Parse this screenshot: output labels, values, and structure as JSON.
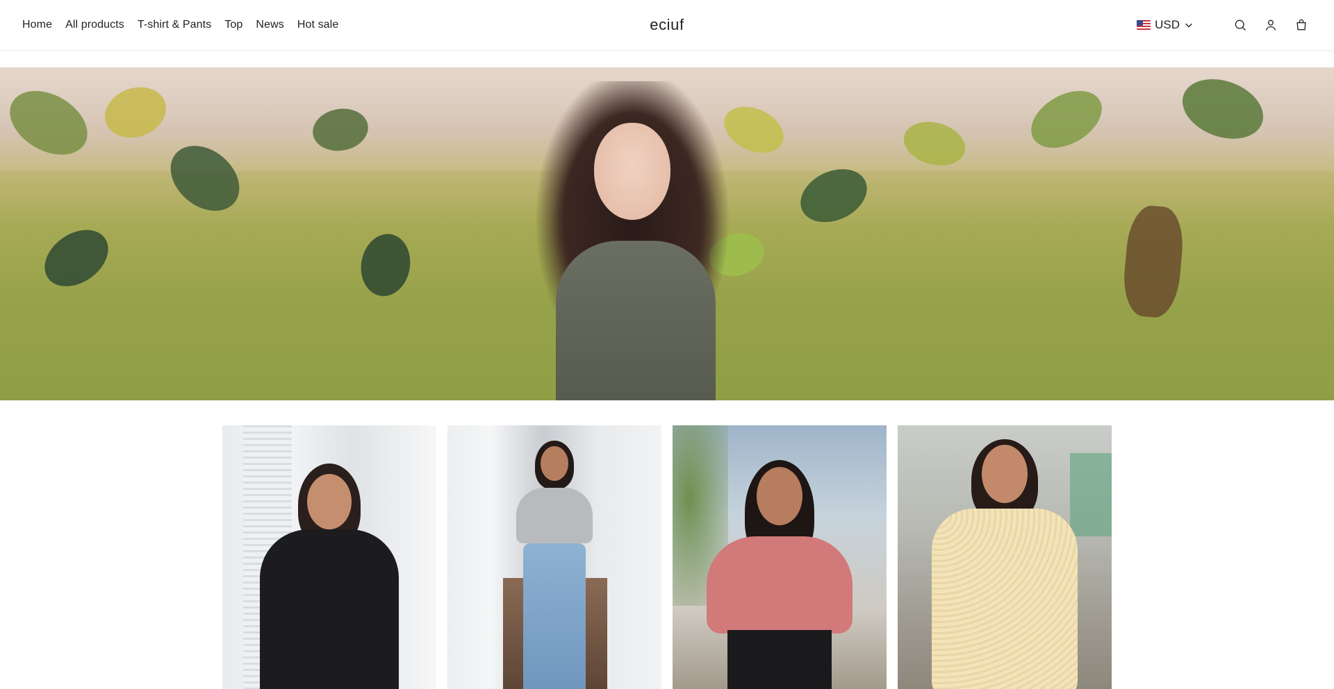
{
  "header": {
    "nav": [
      {
        "label": "Home"
      },
      {
        "label": "All products"
      },
      {
        "label": "T-shirt & Pants"
      },
      {
        "label": "Top"
      },
      {
        "label": "News"
      },
      {
        "label": "Hot sale"
      }
    ],
    "logo": "eciuf",
    "currency": "USD",
    "icons": [
      "flag-us-icon",
      "chevron-down-icon",
      "search-icon",
      "account-icon",
      "cart-icon"
    ]
  },
  "hero": {
    "image": "hero-banner-woman-among-leaves"
  },
  "products": [
    {
      "image": "woman-black-vneck-tshirt"
    },
    {
      "image": "woman-grey-crop-top-jeans"
    },
    {
      "image": "woman-pink-knit-top"
    },
    {
      "image": "woman-yellow-eyelet-blouse"
    }
  ],
  "colors": {
    "text": "#222222",
    "background": "#ffffff"
  }
}
